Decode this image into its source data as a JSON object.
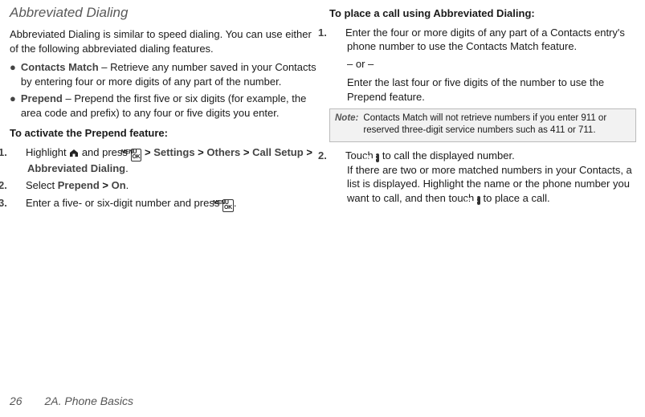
{
  "left": {
    "title": "Abbreviated Dialing",
    "intro": "Abbreviated Dialing is similar to speed dialing. You can use either of the following abbreviated dialing features.",
    "bullets": [
      {
        "term": "Contacts Match",
        "rest": " – Retrieve any number saved in your Contacts by entering four or more digits of any part of the number."
      },
      {
        "term": "Prepend",
        "rest": " – Prepend the first five or six digits (for example, the area code and prefix) to any four or five digits you enter."
      }
    ],
    "activateHead": "To activate the Prepend feature:",
    "step1_a": "Highlight ",
    "step1_b": " and press ",
    "step1_gt": " > ",
    "step1_settings": "Settings",
    "step1_others": "Others",
    "step1_callsetup": "Call Setup",
    "step1_abbr": "Abbreviated Dialing",
    "step1_dot": ".",
    "step2_a": "Select ",
    "step2_prepend": "Prepend",
    "step2_gt": " > ",
    "step2_on": "On",
    "step2_dot": ".",
    "step3_a": "Enter a five- or six-digit number and press ",
    "step3_dot": "."
  },
  "right": {
    "head": "To place a call using Abbreviated Dialing:",
    "s1_a": "Enter the four or more digits of any part of a Contacts entry's phone number to use the Contacts Match feature.",
    "s1_or": "– or –",
    "s1_b": "Enter the last four or five digits of the number to use the Prepend feature.",
    "note_label": "Note:",
    "note_text": "Contacts Match will not retrieve numbers if you enter 911 or reserved three-digit service numbers such as 411 or 711.",
    "s2_a": "Touch ",
    "s2_b": " to call the displayed number.",
    "s2_c": "If there are two or more matched numbers in your Contacts, a list is displayed. Highlight the name or the phone number you want to call, and then touch ",
    "s2_d": " to place a call."
  },
  "footer": {
    "page": "26",
    "section": "2A. Phone Basics"
  },
  "icons": {
    "menu": "MENU\nOK",
    "talk": "TALK"
  }
}
